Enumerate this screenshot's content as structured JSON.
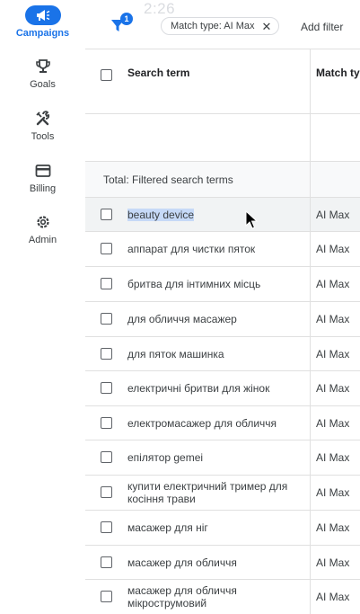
{
  "rail": {
    "items": [
      {
        "label": "Campaigns",
        "icon": "megaphone-icon",
        "active": true
      },
      {
        "label": "Goals",
        "icon": "trophy-icon",
        "active": false
      },
      {
        "label": "Tools",
        "icon": "tools-icon",
        "active": false
      },
      {
        "label": "Billing",
        "icon": "credit-card-icon",
        "active": false
      },
      {
        "label": "Admin",
        "icon": "gear-icon",
        "active": false
      }
    ]
  },
  "filterbar": {
    "filter_count": "1",
    "clock": "2:26",
    "chip_label": "Match type: AI Max",
    "add_filter_label": "Add filter"
  },
  "table": {
    "headers": {
      "term": "Search term",
      "match": "Match typ"
    },
    "total_label": "Total: Filtered search terms",
    "rows": [
      {
        "term": "beauty device",
        "match": "AI Max"
      },
      {
        "term": "аппарат для чистки пяток",
        "match": "AI Max"
      },
      {
        "term": "бритва для інтимних місць",
        "match": "AI Max"
      },
      {
        "term": "для обличчя масажер",
        "match": "AI Max"
      },
      {
        "term": "для пяток машинка",
        "match": "AI Max"
      },
      {
        "term": "електричні бритви для жінок",
        "match": "AI Max"
      },
      {
        "term": "електромасажер для обличчя",
        "match": "AI Max"
      },
      {
        "term": "епілятор gemei",
        "match": "AI Max"
      },
      {
        "term": "купити електричний тример для косіння трави",
        "match": "AI Max"
      },
      {
        "term": "масажер для ніг",
        "match": "AI Max"
      },
      {
        "term": "масажер для обличчя",
        "match": "AI Max"
      },
      {
        "term": "масажер для обличчя мікрострумовий",
        "match": "AI Max"
      }
    ]
  },
  "colors": {
    "accent": "#1a73e8",
    "selection": "#c6d9f7"
  }
}
